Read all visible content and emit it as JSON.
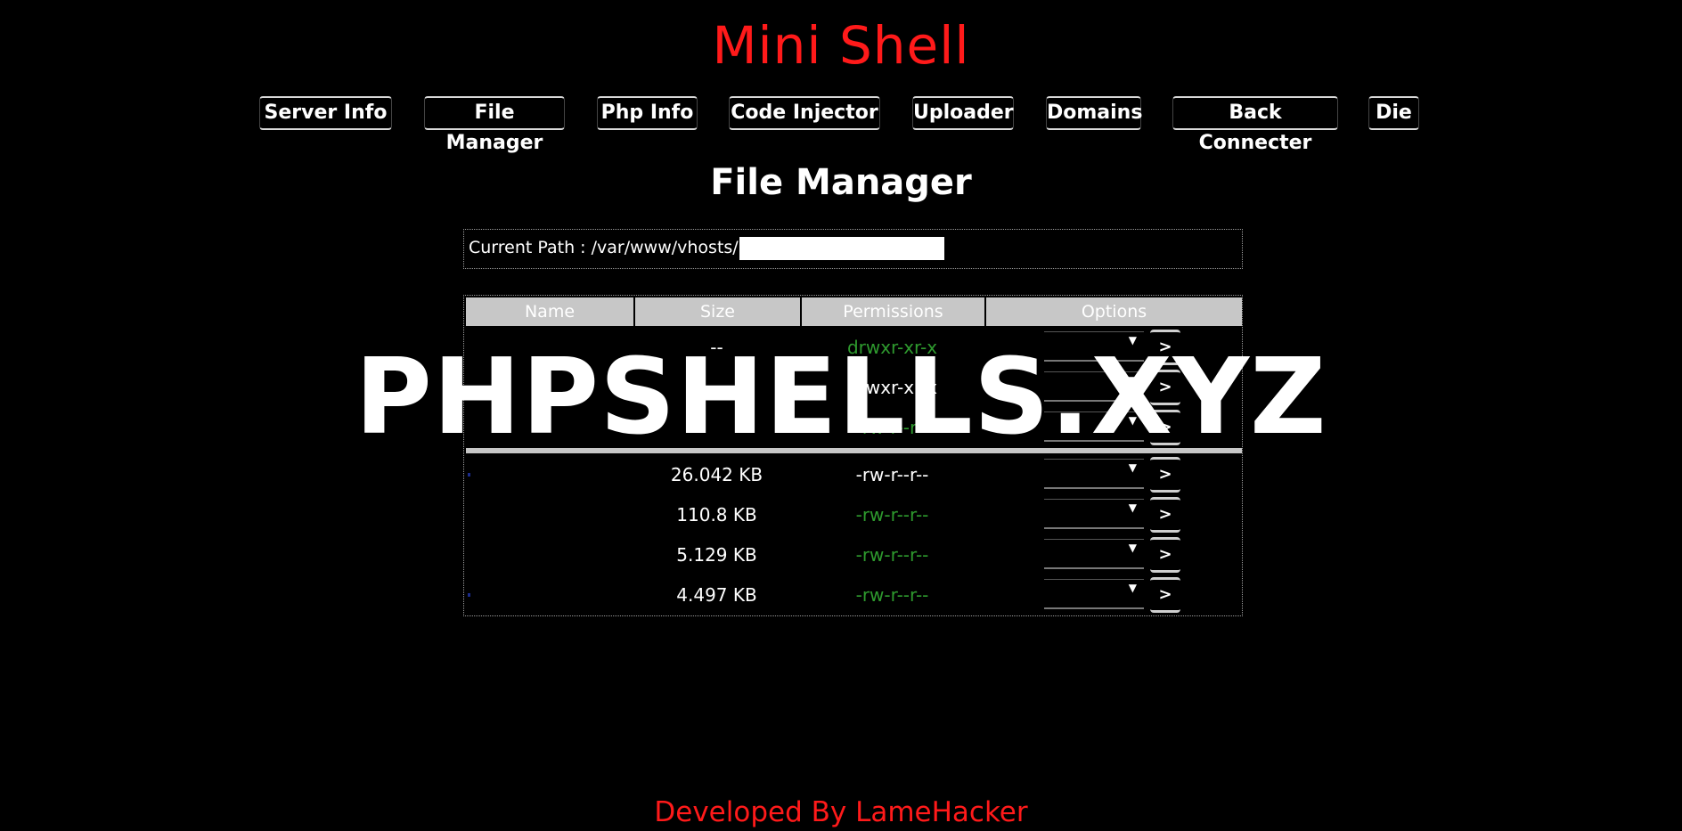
{
  "header": {
    "title": "Mini Shell"
  },
  "nav": {
    "items": [
      {
        "label": "Server Info"
      },
      {
        "label": "File Manager"
      },
      {
        "label": "Php Info"
      },
      {
        "label": "Code Injector"
      },
      {
        "label": "Uploader"
      },
      {
        "label": "Domains"
      },
      {
        "label": "Back Connecter"
      },
      {
        "label": "Die"
      }
    ]
  },
  "main": {
    "section_title": "File Manager",
    "current_path_label": "Current Path : /var/www/vhosts/",
    "table": {
      "columns": [
        "Name",
        "Size",
        "Permissions",
        "Options"
      ],
      "rows": [
        {
          "name": "",
          "size": "--",
          "permissions": "drwxr-xr-x",
          "perm_color": "green"
        },
        {
          "name": "",
          "size": "",
          "permissions": "drwxr-xr-x",
          "perm_color": "white"
        },
        {
          "name": "",
          "size": "",
          "permissions": "-rw-r--r--",
          "perm_color": "green"
        },
        {
          "name": "",
          "size": "26.042 KB",
          "permissions": "-rw-r--r--",
          "perm_color": "white"
        },
        {
          "name": "",
          "size": "110.8 KB",
          "permissions": "-rw-r--r--",
          "perm_color": "green"
        },
        {
          "name": "",
          "size": "5.129 KB",
          "permissions": "-rw-r--r--",
          "perm_color": "green"
        },
        {
          "name": "",
          "size": "4.497 KB",
          "permissions": "-rw-r--r--",
          "perm_color": "green"
        }
      ],
      "go_label": ">",
      "select_arrow": "▼"
    }
  },
  "watermark": {
    "text": "PHPSHELLS.XYZ"
  },
  "footer": {
    "text": "Developed By LameHacker"
  },
  "colors": {
    "title": "#ff1a1a",
    "background": "#000000",
    "permission_green": "#2e9a2e",
    "header_cell": "#c7c7c7"
  }
}
